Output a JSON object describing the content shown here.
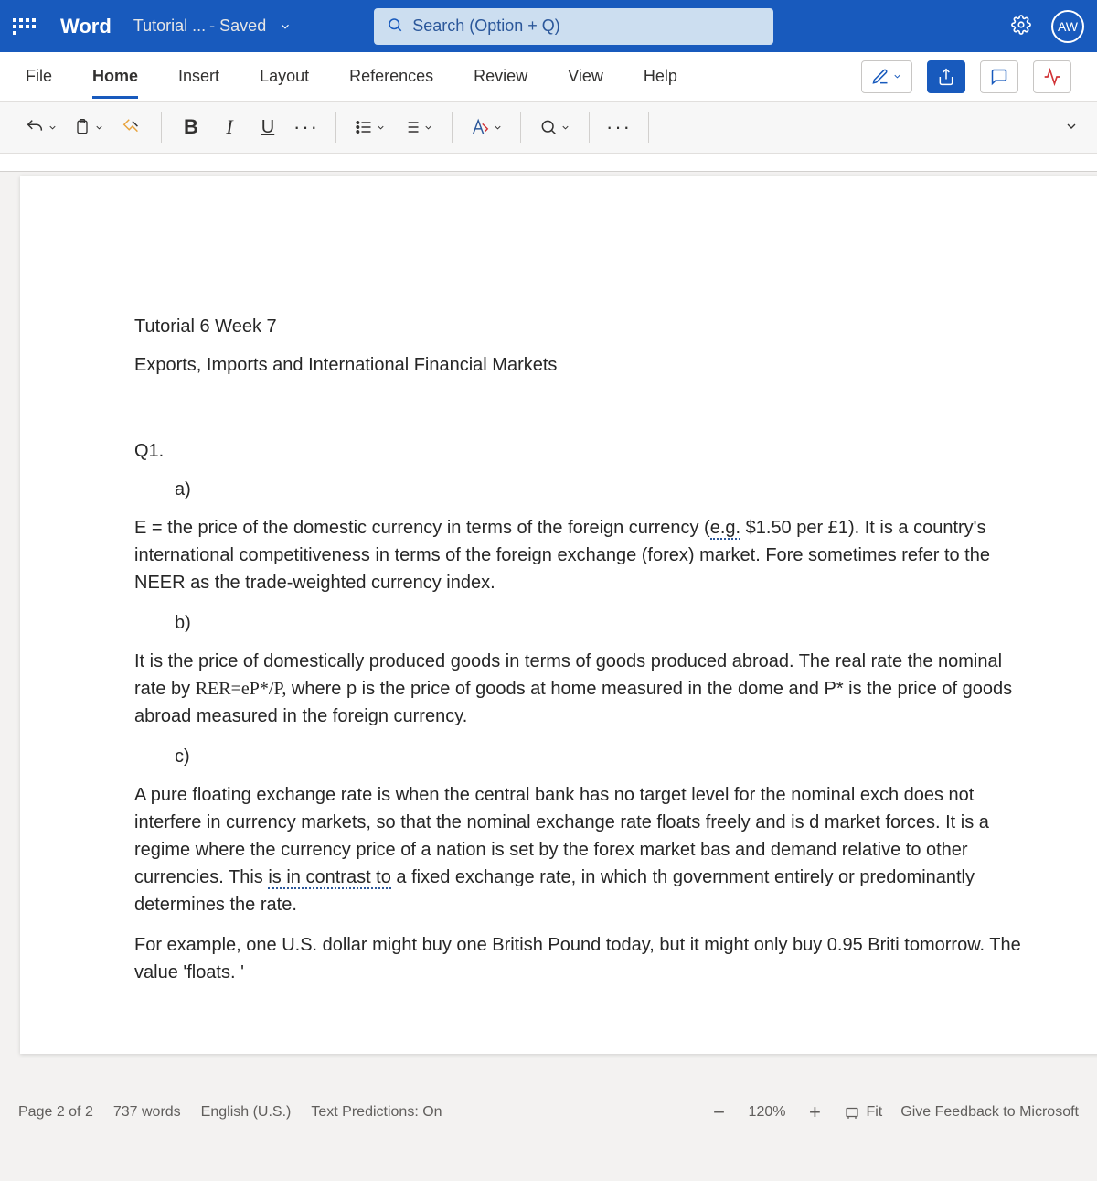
{
  "title": {
    "app": "Word",
    "doc": "Tutorial ...",
    "saved": "- Saved",
    "search_placeholder": "Search (Option + Q)",
    "avatar": "AW"
  },
  "tabs": {
    "file": "File",
    "home": "Home",
    "insert": "Insert",
    "layout": "Layout",
    "references": "References",
    "review": "Review",
    "view": "View",
    "help": "Help"
  },
  "toolbar": {
    "bold": "B",
    "italic": "I",
    "underline": "U"
  },
  "doc": {
    "heading1": "Tutorial 6 Week 7",
    "heading2": "Exports, Imports and International Financial Markets",
    "q1": "Q1.",
    "a": "a)",
    "para_a_1": "E = the price of the domestic currency in terms of the foreign currency (",
    "eg": "e.g.",
    "para_a_2": " $1.50 per £1). It is a country's international competitiveness in terms of the foreign exchange (forex) market. Fore sometimes refer to the NEER as the trade-weighted currency index.",
    "b": "b)",
    "para_b_1": "It is the price of domestically produced goods in terms of goods produced abroad. The real rate the nominal rate by ",
    "formula1": "RER=",
    "formula_err": "eP",
    "formula2": "*/P,",
    "para_b_2": " where p is the price of goods at home measured in the dome and P* is the price of goods abroad measured in the foreign currency.",
    "c": "c)",
    "para_c_1": "A pure floating exchange rate is when the central bank has no target level for the nominal exch does not interfere in currency markets, so that the nominal exchange rate floats freely and is d market forces. It is a regime where the currency price of a nation is set by the forex market bas and demand relative to other currencies. This ",
    "contrast": "is in contrast to",
    "para_c_2": " a fixed exchange rate, in which th government entirely or predominantly determines the rate.",
    "para_d": "For example, one U.S. dollar might buy one British Pound today, but it might only buy 0.95 Briti tomorrow. The value 'floats. '"
  },
  "status": {
    "page": "Page 2 of 2",
    "words": "737 words",
    "lang": "English (U.S.)",
    "pred": "Text Predictions: On",
    "zoom_minus": "−",
    "zoom": "120%",
    "zoom_plus": "+",
    "fit": "Fit",
    "feedback": "Give Feedback to Microsoft"
  }
}
